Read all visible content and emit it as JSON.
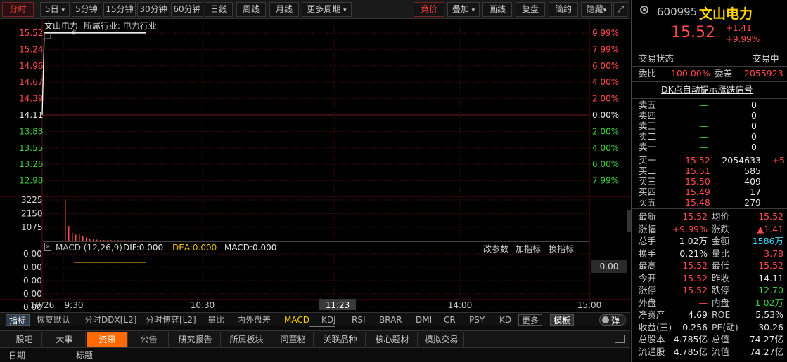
{
  "toolbar": {
    "items": [
      "分时",
      "5日",
      "5分钟",
      "15分钟",
      "30分钟",
      "60分钟",
      "日线",
      "周线",
      "月线",
      "更多周期"
    ],
    "right_items": [
      "竞价",
      "叠加",
      "画线",
      "复盘",
      "简约",
      "隐藏"
    ],
    "dropdown_glyph": "▾",
    "expand_glyph": "⤢"
  },
  "chart_header": {
    "stock": "文山电力",
    "industry": "所属行业: 电力行业",
    "close_glyph": "×"
  },
  "chart_data": {
    "type": "line",
    "title": "文山电力",
    "price_ticks": [
      "15.52",
      "15.24",
      "14.96",
      "14.67",
      "14.39",
      "14.11",
      "13.83",
      "13.55",
      "13.26",
      "12.98"
    ],
    "pct_ticks": [
      "9.99%",
      "7.99%",
      "6.00%",
      "4.00%",
      "2.00%",
      "0.00%",
      "2.00%",
      "4.00%",
      "6.00%",
      "7.99%"
    ],
    "price_range": [
      12.7,
      15.52
    ],
    "prev_close": 14.11,
    "x_labels": [
      "10/26",
      "9:30",
      "10:30",
      "11:23",
      "14:00",
      "15:00"
    ],
    "price_series": [
      {
        "t": "9:25",
        "v": 14.11
      },
      {
        "t": "9:26",
        "v": 15.52
      },
      {
        "t": "9:30",
        "v": 15.52
      }
    ],
    "volume_ticks": [
      "3225",
      "2150",
      "1075"
    ],
    "volume_max": 3225,
    "volume_bars": [
      3100,
      1100,
      600,
      450,
      500,
      350,
      250,
      150,
      100,
      80,
      60,
      50,
      40,
      40,
      30,
      30,
      25,
      25,
      20,
      20,
      20,
      20,
      20
    ],
    "macd_ticks": [
      "0.00",
      "0.00",
      "0.00",
      "0.00",
      "0.00"
    ],
    "macd_label": "0.00",
    "cursor_time": "11:23"
  },
  "macd_bar": {
    "name": "MACD (12,26,9)",
    "dif": "DIF:0.000–",
    "dea": "DEA:0.000–",
    "macd": "MACD:0.000–",
    "actions": [
      "改参数",
      "加指标",
      "换指标"
    ]
  },
  "indicator_bar": {
    "items": [
      "指标",
      "恢复默认",
      "分时DDX[L2]",
      "分时博弈[L2]",
      "量比",
      "内外盘差",
      "MACD",
      "KDJ",
      "RSI",
      "BRAR",
      "DMI",
      "CR",
      "PSY",
      "KD"
    ],
    "more": "更多",
    "template": "模板",
    "toggle": "弹"
  },
  "tabs": {
    "items": [
      "股吧",
      "大事",
      "资讯",
      "公告",
      "研究报告",
      "所属板块",
      "问董秘",
      "关联品种",
      "核心题材",
      "模拟交易"
    ],
    "active": 2
  },
  "news_header": {
    "col_date": "日期",
    "col_title": "标题"
  },
  "quote": {
    "code": "600995",
    "name": "文山电力",
    "price": "15.52",
    "change": "+1.41",
    "change_pct": "+9.99%",
    "state_label": "交易状态",
    "state_value": "交易中",
    "weibi_label": "委比",
    "weibi_value": "100.00%",
    "weicha_label": "委差",
    "weicha_value": "2055923",
    "dk_link": "DK点自动提示涨跌信号",
    "sells": [
      {
        "label": "卖五",
        "price": "—",
        "vol": "0"
      },
      {
        "label": "卖四",
        "price": "—",
        "vol": "0"
      },
      {
        "label": "卖三",
        "price": "—",
        "vol": "0"
      },
      {
        "label": "卖二",
        "price": "—",
        "vol": "0"
      },
      {
        "label": "卖一",
        "price": "—",
        "vol": "0"
      }
    ],
    "buys": [
      {
        "label": "买一",
        "price": "15.52",
        "vol": "2054633",
        "chg": "+5"
      },
      {
        "label": "买二",
        "price": "15.51",
        "vol": "585",
        "chg": ""
      },
      {
        "label": "买三",
        "price": "15.50",
        "vol": "409",
        "chg": ""
      },
      {
        "label": "买四",
        "price": "15.49",
        "vol": "17",
        "chg": ""
      },
      {
        "label": "买五",
        "price": "15.48",
        "vol": "279",
        "chg": ""
      }
    ],
    "stats": [
      {
        "l1": "最新",
        "v1": "15.52",
        "c1": "red",
        "l2": "均价",
        "v2": "15.52",
        "c2": "red"
      },
      {
        "l1": "涨幅",
        "v1": "+9.99%",
        "c1": "red",
        "l2": "涨跌",
        "v2": "▲1.41",
        "c2": "red"
      },
      {
        "l1": "总手",
        "v1": "1.02万",
        "c1": "white",
        "l2": "金额",
        "v2": "1586万",
        "c2": "cyan"
      },
      {
        "l1": "换手",
        "v1": "0.21%",
        "c1": "white",
        "l2": "量比",
        "v2": "3.78",
        "c2": "red"
      },
      {
        "l1": "最高",
        "v1": "15.52",
        "c1": "red",
        "l2": "最低",
        "v2": "15.52",
        "c2": "red"
      },
      {
        "l1": "今开",
        "v1": "15.52",
        "c1": "red",
        "l2": "昨收",
        "v2": "14.11",
        "c2": "white"
      },
      {
        "l1": "涨停",
        "v1": "15.52",
        "c1": "red",
        "l2": "跌停",
        "v2": "12.70",
        "c2": "green"
      },
      {
        "l1": "外盘",
        "v1": "—",
        "c1": "red",
        "l2": "内盘",
        "v2": "1.02万",
        "c2": "green"
      },
      {
        "l1": "净资产",
        "v1": "4.69",
        "c1": "white",
        "l2": "ROE",
        "v2": "5.53%",
        "c2": "white"
      },
      {
        "l1": "收益(三)",
        "v1": "0.256",
        "c1": "white",
        "l2": "PE(动)",
        "v2": "30.26",
        "c2": "white"
      },
      {
        "l1": "总股本",
        "v1": "4.785亿",
        "c1": "white",
        "l2": "总值",
        "v2": "74.27亿",
        "c2": "white"
      },
      {
        "l1": "流通股",
        "v1": "4.785亿",
        "c1": "white",
        "l2": "流值",
        "v2": "74.27亿",
        "c2": "white"
      }
    ]
  },
  "colors": {
    "up": "#ff4b4b",
    "down": "#3ccf3c",
    "accent": "#ff6a00",
    "price_line": "#ffffff",
    "ma_line": "#e8c000"
  }
}
